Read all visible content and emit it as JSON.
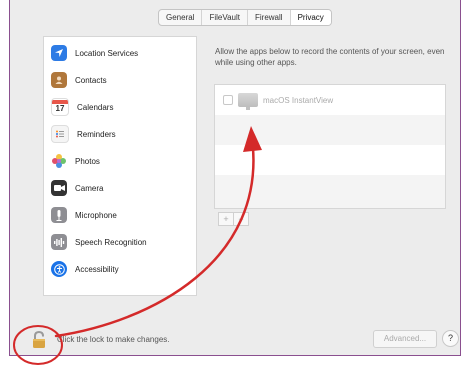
{
  "tabs": [
    {
      "label": "General"
    },
    {
      "label": "FileVault"
    },
    {
      "label": "Firewall"
    },
    {
      "label": "Privacy"
    }
  ],
  "active_tab": "Privacy",
  "sidebar": {
    "items": [
      {
        "label": "Location Services",
        "icon": "location-arrow-icon",
        "color": "#2d7be5"
      },
      {
        "label": "Contacts",
        "icon": "contacts-book-icon",
        "color": "#b0773b"
      },
      {
        "label": "Calendars",
        "icon": "calendar-icon",
        "color": "#e8574a"
      },
      {
        "label": "Reminders",
        "icon": "reminders-list-icon",
        "color": "#f5f5f5"
      },
      {
        "label": "Photos",
        "icon": "photos-flower-icon",
        "color": "#f2a23a"
      },
      {
        "label": "Camera",
        "icon": "camera-icon",
        "color": "#333333"
      },
      {
        "label": "Microphone",
        "icon": "microphone-icon",
        "color": "#8e8e93"
      },
      {
        "label": "Speech Recognition",
        "icon": "waveform-icon",
        "color": "#8e8e93"
      },
      {
        "label": "Accessibility",
        "icon": "accessibility-icon",
        "color": "#1a73e8"
      }
    ]
  },
  "main": {
    "description": "Allow the apps below to record the contents of your screen, even while using other apps.",
    "apps": [
      {
        "name": "macOS InstantView",
        "checked": false,
        "icon": "monitor-icon"
      }
    ],
    "add_label": "+",
    "remove_label": "−"
  },
  "footer": {
    "lock_text": "Click the lock to make changes.",
    "advanced_label": "Advanced...",
    "help_label": "?"
  },
  "colors": {
    "annotation_red": "#d42a2a",
    "window_border": "#8a4f8f"
  }
}
